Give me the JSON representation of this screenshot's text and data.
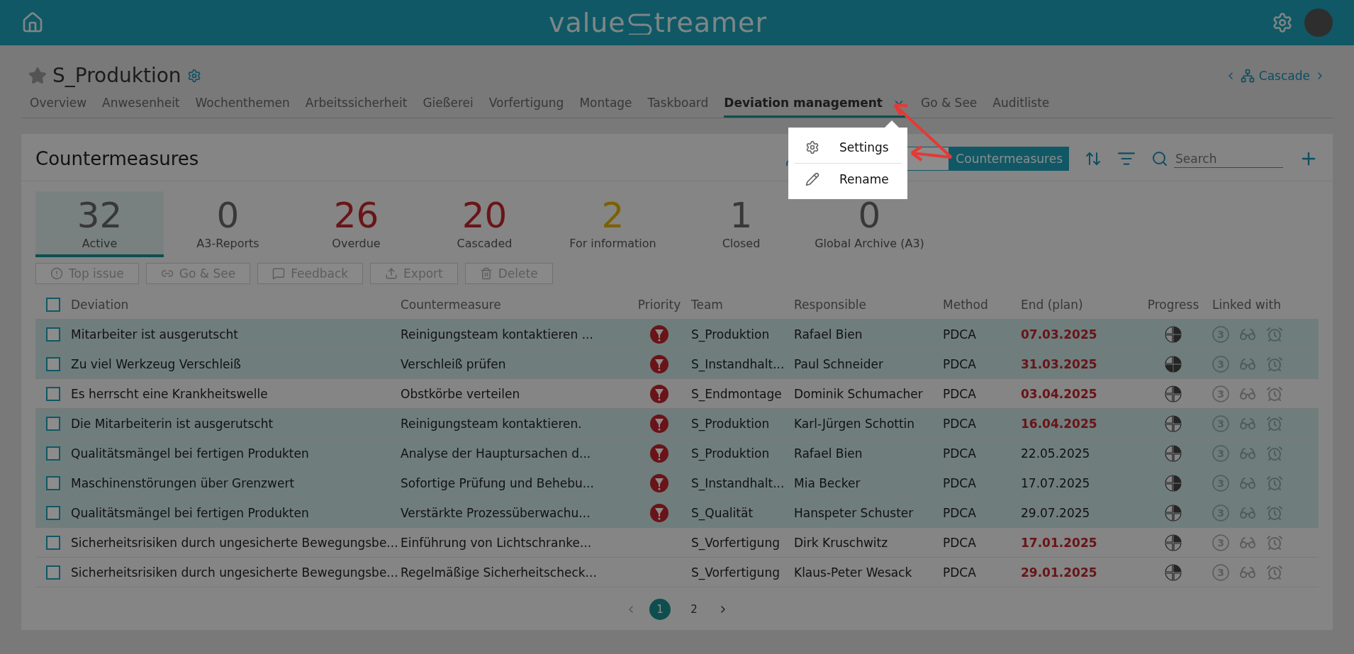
{
  "header": {
    "logo_left": "value",
    "logo_right": "treamer"
  },
  "board": {
    "title": "S_Produktion",
    "favorite": false,
    "cascade": "Cascade"
  },
  "tabs": [
    {
      "label": "Overview",
      "selected": false
    },
    {
      "label": "Anwesenheit",
      "selected": false
    },
    {
      "label": "Wochenthemen",
      "selected": false
    },
    {
      "label": "Arbeitssicherheit",
      "selected": false
    },
    {
      "label": "Gießerei",
      "selected": false
    },
    {
      "label": "Vorfertigung",
      "selected": false
    },
    {
      "label": "Montage",
      "selected": false
    },
    {
      "label": "Taskboard",
      "selected": false
    },
    {
      "label": "Deviation management",
      "selected": true
    },
    {
      "label": "Go & See",
      "selected": false
    },
    {
      "label": "Auditliste",
      "selected": false
    }
  ],
  "panel": {
    "title": "Countermeasures",
    "view_button": "Countermeasures",
    "search": {
      "placeholder": "Search"
    }
  },
  "counters": [
    {
      "value": "32",
      "label": "Active",
      "selected": true,
      "color": "#383838"
    },
    {
      "value": "0",
      "label": "A3-Reports",
      "selected": false,
      "color": "#383838"
    },
    {
      "value": "26",
      "label": "Overdue",
      "selected": false,
      "color": "#6a1518"
    },
    {
      "value": "20",
      "label": "Cascaded",
      "selected": false,
      "color": "#6a1518"
    },
    {
      "value": "2",
      "label": "For information",
      "selected": false,
      "color": "#7c6100"
    },
    {
      "value": "1",
      "label": "Closed",
      "selected": false,
      "color": "#383838"
    },
    {
      "value": "0",
      "label": "Global Archive (A3)",
      "selected": false,
      "color": "#383838"
    }
  ],
  "actions": [
    "Top issue",
    "Go & See",
    "Feedback",
    "Export",
    "Delete"
  ],
  "select_all": {
    "checked": false
  },
  "columns": [
    "Deviation",
    "Countermeasure",
    "Priority",
    "Team",
    "Responsible",
    "Method",
    "End (plan)",
    "Progress",
    "Linked with"
  ],
  "rows": [
    {
      "deviation": "Mitarbeiter ist ausgerutscht",
      "countermeasure": "Reinigungsteam kontaktieren ...",
      "priority": true,
      "team": "S_Produktion",
      "responsible": "Rafael Bien",
      "method": "PDCA",
      "end": "07.03.2025",
      "overdue": true,
      "progress": {
        "kind": "half"
      },
      "highlighted": true,
      "checked": false,
      "links": "3"
    },
    {
      "deviation": "Zu viel Werkzeug Verschleiß",
      "countermeasure": "Verschleiß prüfen",
      "priority": true,
      "team": "S_Instandhalt...",
      "responsible": "Paul Schneider",
      "method": "PDCA",
      "end": "31.03.2025",
      "overdue": true,
      "progress": {
        "kind": "three-quarters"
      },
      "highlighted": true,
      "checked": false,
      "links": "3"
    },
    {
      "deviation": "Es herrscht eine Krankheitswelle",
      "countermeasure": "Obstkörbe verteilen",
      "priority": true,
      "team": "S_Endmontage",
      "responsible": "Dominik Schumacher",
      "method": "PDCA",
      "end": "03.04.2025",
      "overdue": true,
      "progress": {
        "kind": "quarter"
      },
      "highlighted": false,
      "checked": false,
      "links": "3"
    },
    {
      "deviation": "Die Mitarbeiterin ist ausgerutscht",
      "countermeasure": "Reinigungsteam kontaktieren.",
      "priority": true,
      "team": "S_Produktion",
      "responsible": "Karl-Jürgen Schottin",
      "method": "PDCA",
      "end": "16.04.2025",
      "overdue": true,
      "progress": {
        "kind": "quarter"
      },
      "highlighted": true,
      "checked": false,
      "links": "3"
    },
    {
      "deviation": "Qualitätsmängel bei fertigen Produkten",
      "countermeasure": "Analyse der Hauptursachen d...",
      "priority": true,
      "team": "S_Produktion",
      "responsible": "Rafael Bien",
      "method": "PDCA",
      "end": "22.05.2025",
      "overdue": false,
      "progress": {
        "kind": "quarter"
      },
      "highlighted": true,
      "checked": false,
      "links": "3"
    },
    {
      "deviation": "Maschinenstörungen über Grenzwert",
      "countermeasure": "Sofortige Prüfung und Behebu...",
      "priority": true,
      "team": "S_Instandhalt...",
      "responsible": "Mia Becker",
      "method": "PDCA",
      "end": "17.07.2025",
      "overdue": false,
      "progress": {
        "kind": "half"
      },
      "highlighted": true,
      "checked": false,
      "links": "3"
    },
    {
      "deviation": "Qualitätsmängel bei fertigen Produkten",
      "countermeasure": "Verstärkte Prozessüberwachu...",
      "priority": true,
      "team": "S_Qualität",
      "responsible": "Hanspeter Schuster",
      "method": "PDCA",
      "end": "29.07.2025",
      "overdue": false,
      "progress": {
        "kind": "quarter"
      },
      "highlighted": true,
      "checked": false,
      "links": "3"
    },
    {
      "deviation": "Sicherheitsrisiken durch ungesicherte Bewegungsbe...",
      "countermeasure": "Einführung von Lichtschranke...",
      "priority": false,
      "team": "S_Vorfertigung",
      "responsible": "Dirk Kruschwitz",
      "method": "PDCA",
      "end": "17.01.2025",
      "overdue": true,
      "progress": {
        "kind": "quarter"
      },
      "highlighted": false,
      "checked": false,
      "links": "3"
    },
    {
      "deviation": "Sicherheitsrisiken durch ungesicherte Bewegungsbe...",
      "countermeasure": "Regelmäßige Sicherheitscheck...",
      "priority": false,
      "team": "S_Vorfertigung",
      "responsible": "Klaus-Peter Wesack",
      "method": "PDCA",
      "end": "29.01.2025",
      "overdue": true,
      "progress": {
        "kind": "quarter"
      },
      "highlighted": false,
      "checked": false,
      "links": "3"
    }
  ],
  "pagination": [
    {
      "label": "1",
      "selected": true
    },
    {
      "label": "2",
      "selected": false
    }
  ],
  "menu": [
    {
      "kind": "settings",
      "label": "Settings"
    },
    {
      "kind": "rename",
      "label": "Rename"
    }
  ]
}
